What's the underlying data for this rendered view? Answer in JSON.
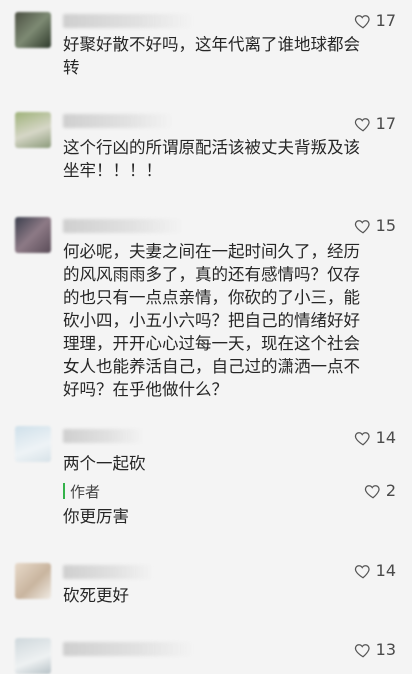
{
  "comments": [
    {
      "likes": "17",
      "text": "好聚好散不好吗，这年代离了谁地球都会\n转"
    },
    {
      "likes": "17",
      "text": "这个行凶的所谓原配活该被丈夫背叛及该\n坐牢！！！！"
    },
    {
      "likes": "15",
      "text": "何必呢，夫妻之间在一起时间久了，经历\n的风风雨雨多了，真的还有感情吗？仅存\n的也只有一点点亲情，你砍的了小三，能\n砍小四，小五小六吗？把自己的情绪好好\n理理，开开心心过每一天，现在这个社会\n女人也能养活自己，自己过的潇洒一点不\n好吗？在乎他做什么？"
    },
    {
      "likes": "14",
      "text": "两个一起砍",
      "reply": {
        "tag": "作者",
        "likes": "2",
        "text": "你更厉害"
      }
    },
    {
      "likes": "14",
      "text": "砍死更好"
    },
    {
      "likes": "13",
      "text": ""
    }
  ],
  "icons": {
    "like": "heart-outline-icon"
  }
}
